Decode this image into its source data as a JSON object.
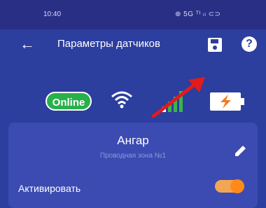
{
  "status_bar": {
    "time": "10:40",
    "icons": "⊕ 5G ᵀᴵ ₗₗ ⊂⊃"
  },
  "toolbar": {
    "title": "Параметры датчиков"
  },
  "indicators": {
    "online_label": "Online"
  },
  "sensor": {
    "name": "Ангар",
    "zone": "Проводная зона №1",
    "activate_label": "Активировать",
    "activated": true
  },
  "colors": {
    "primary": "#2c3e9e",
    "card": "#3b4bb2",
    "online": "#28b04a",
    "accent": "#ff8a1a"
  }
}
